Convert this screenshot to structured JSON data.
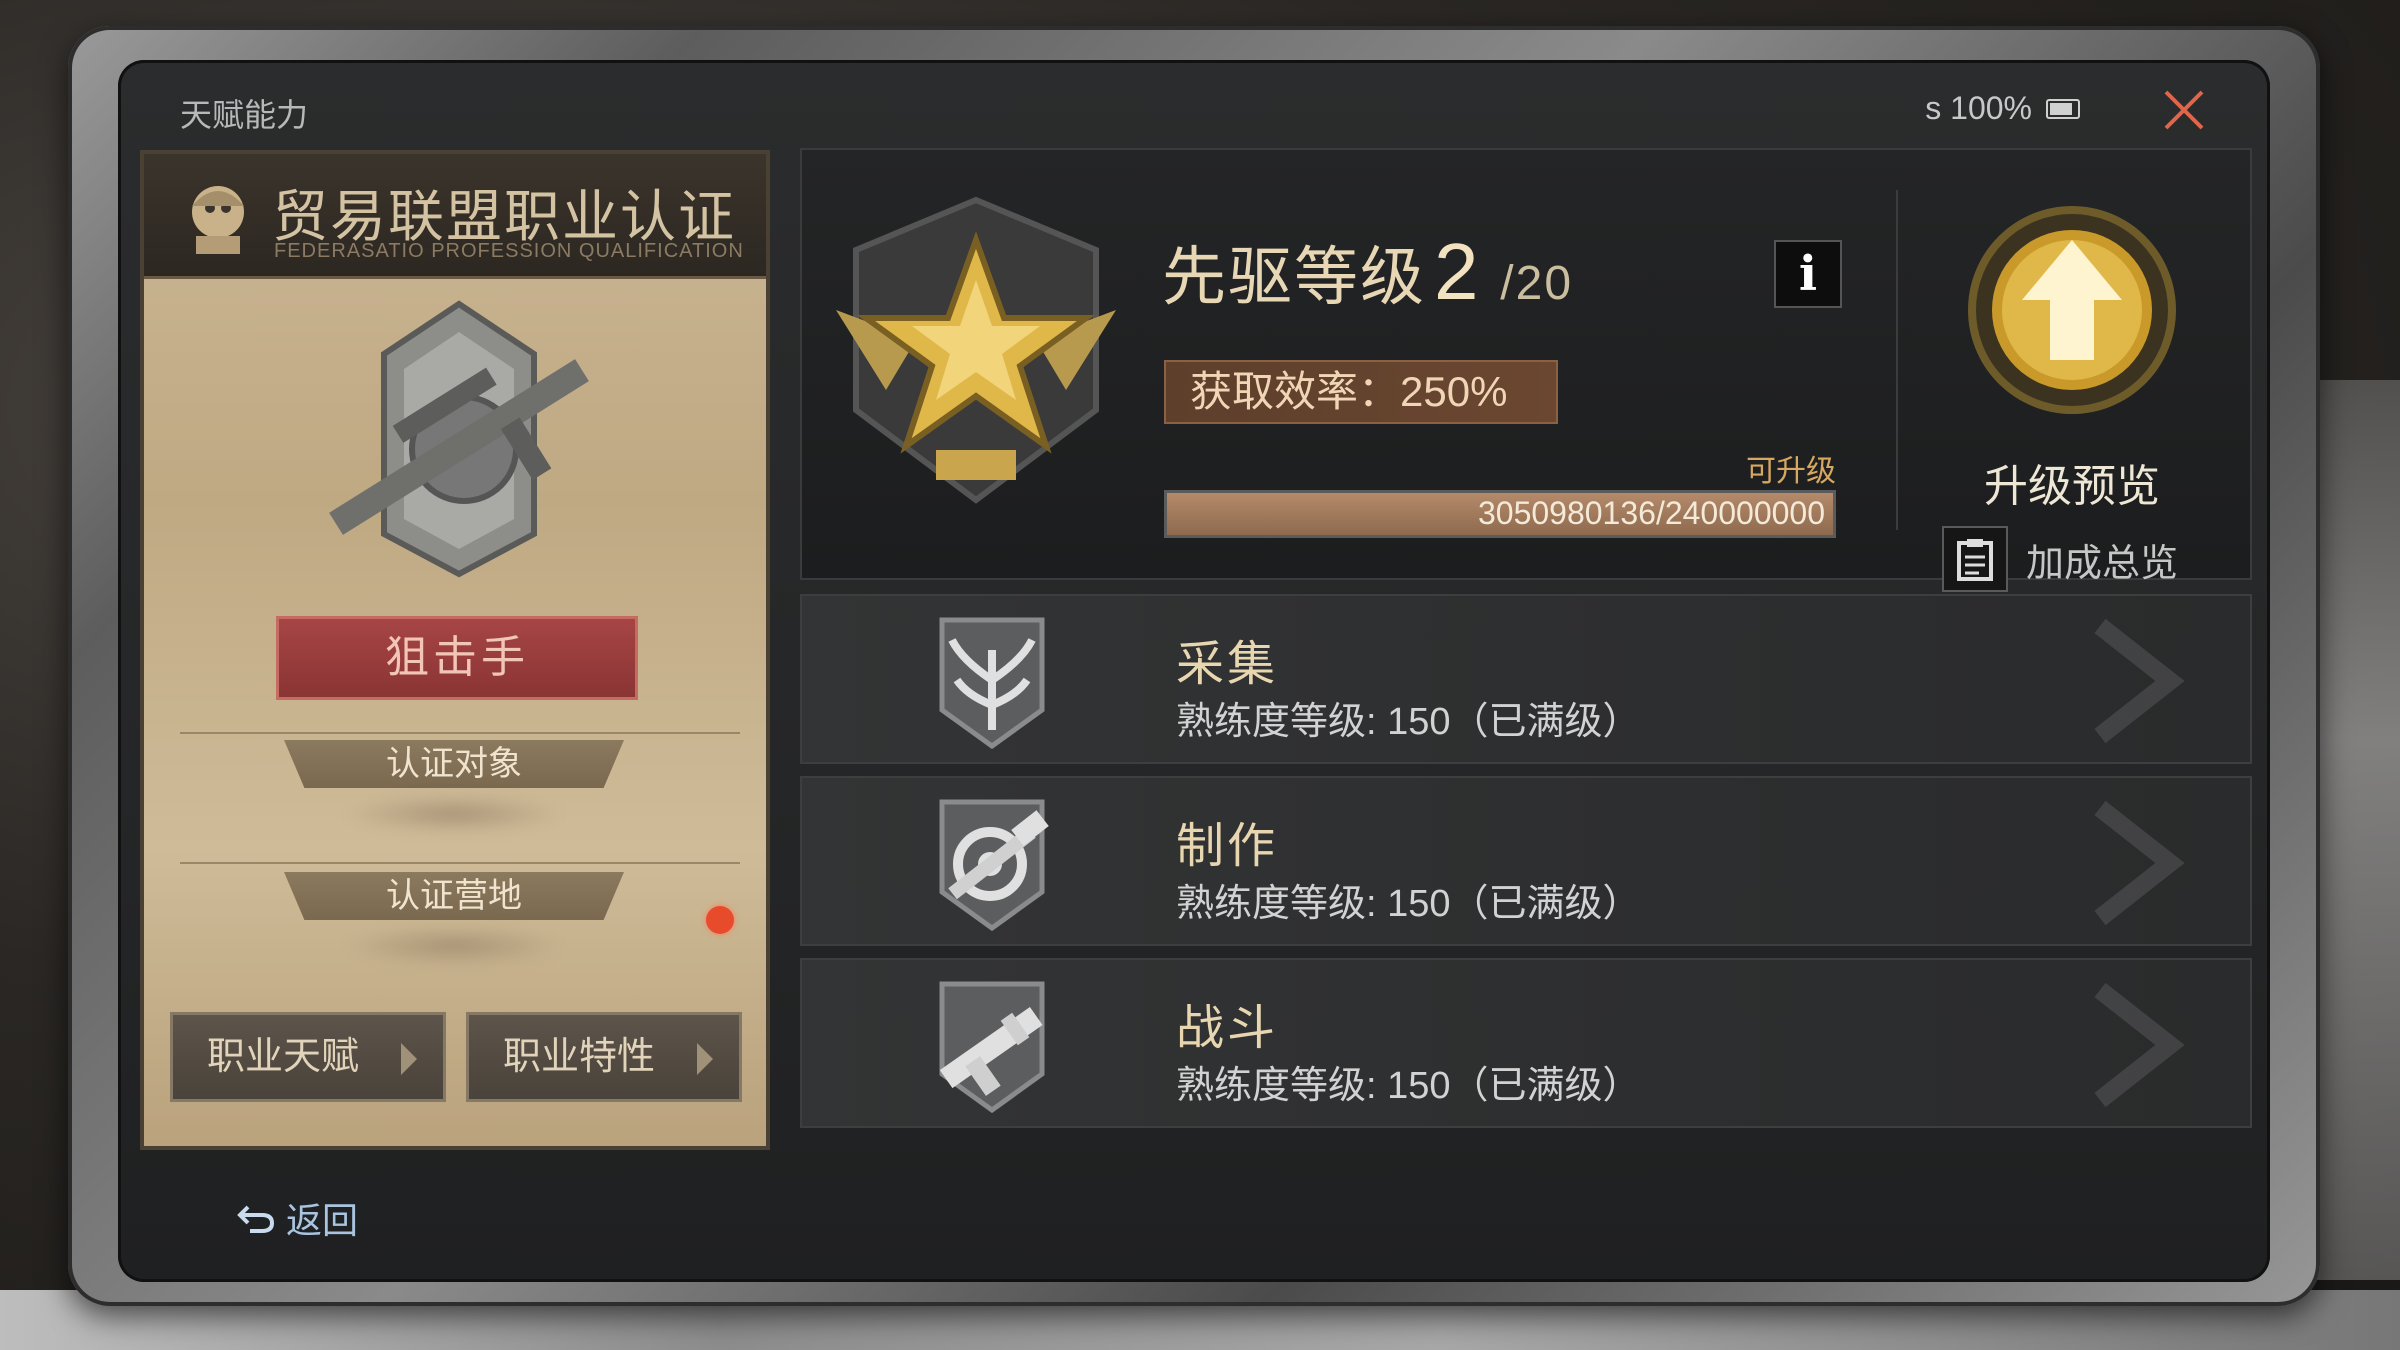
{
  "window": {
    "title": "天赋能力",
    "battery_text": "s 100%"
  },
  "certificate": {
    "title": "贸易联盟职业认证",
    "subtitle": "FEDERASATIO PROFESSION QUALIFICATION",
    "role": "狙击手",
    "target_label": "认证对象",
    "camp_label": "认证营地",
    "buttons": {
      "talent": "职业天赋",
      "trait": "职业特性"
    }
  },
  "rank": {
    "title": "先驱等级",
    "level": "2",
    "max": "/20",
    "info_label": "i",
    "efficiency": "获取效率：250%",
    "upgradable": "可升级",
    "xp_text": "3050980136/240000000",
    "xp_fraction": 1.0,
    "upgrade_preview": "升级预览",
    "bonus_overview": "加成总览"
  },
  "skills": [
    {
      "name": "采集",
      "level": "熟练度等级: 150（已满级）",
      "icon": "gather-icon"
    },
    {
      "name": "制作",
      "level": "熟练度等级: 150（已满级）",
      "icon": "craft-icon"
    },
    {
      "name": "战斗",
      "level": "熟练度等级: 150（已满级）",
      "icon": "combat-icon"
    }
  ],
  "nav": {
    "back": "返回"
  },
  "colors": {
    "accent_gold": "#e0b84a",
    "role_red": "#a74545",
    "notify": "#e84b2c"
  }
}
